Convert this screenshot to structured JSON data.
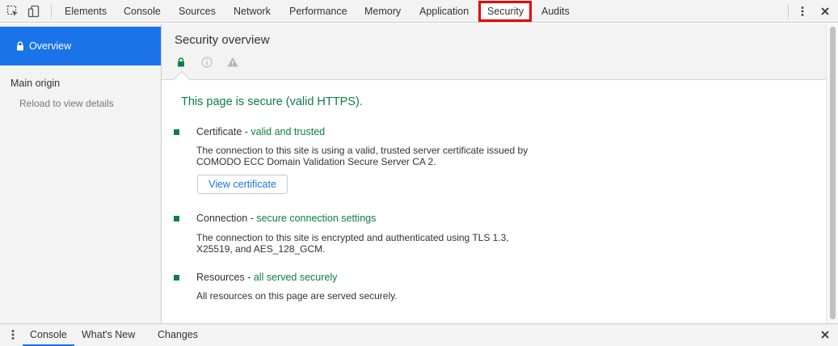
{
  "toolbar": {
    "tabs": [
      "Elements",
      "Console",
      "Sources",
      "Network",
      "Performance",
      "Memory",
      "Application",
      "Security",
      "Audits"
    ],
    "active_tab": "Security",
    "icons": [
      "inspect-element-icon",
      "device-toolbar-icon",
      "more-vert-icon",
      "close-icon"
    ]
  },
  "sidebar": {
    "active_item": "Overview",
    "main_origin_heading": "Main origin",
    "main_origin_hint": "Reload to view details"
  },
  "main": {
    "title": "Security overview",
    "summary_icons": [
      "lock-icon",
      "info-icon",
      "warning-icon"
    ],
    "headline": "This page is secure (valid HTTPS).",
    "sections": {
      "certificate": {
        "title": "Certificate",
        "status": "valid and trusted",
        "description": "The connection to this site is using a valid, trusted server certificate issued by COMODO ECC Domain Validation Secure Server CA 2.",
        "button_label": "View certificate"
      },
      "connection": {
        "title": "Connection",
        "status": "secure connection settings",
        "description": "The connection to this site is encrypted and authenticated using TLS 1.3, X25519, and AES_128_GCM."
      },
      "resources": {
        "title": "Resources",
        "status": "all served securely",
        "description": "All resources on this page are served securely."
      }
    }
  },
  "drawer": {
    "tabs": [
      "Console",
      "What's New",
      "Changes"
    ],
    "active_tab": "Console"
  },
  "colors": {
    "accent": "#1a73e8",
    "secure_green": "#0b8043",
    "highlight_red": "#e60000"
  }
}
